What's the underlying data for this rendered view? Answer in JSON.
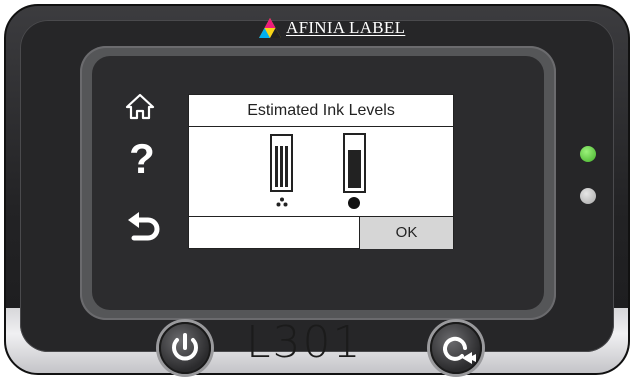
{
  "brand": {
    "name": "AFINIA LABEL"
  },
  "device": {
    "model": "L301"
  },
  "side_menu": {
    "home_icon": "home-icon",
    "help_icon": "help-icon",
    "help_label": "?",
    "back_icon": "back-arrow-icon"
  },
  "dialog": {
    "title": "Estimated Ink Levels",
    "ok_label": "OK",
    "cartridges": [
      {
        "name": "color",
        "level": 0.85,
        "icon": "color-dots-icon"
      },
      {
        "name": "black",
        "level": 0.75,
        "icon": "black-drop-icon"
      }
    ]
  },
  "leds": {
    "status_color": "#43b02a",
    "secondary_color": "#a8a8a8"
  },
  "hardware_buttons": {
    "power_icon": "power-icon",
    "feed_icon": "feed-icon"
  }
}
